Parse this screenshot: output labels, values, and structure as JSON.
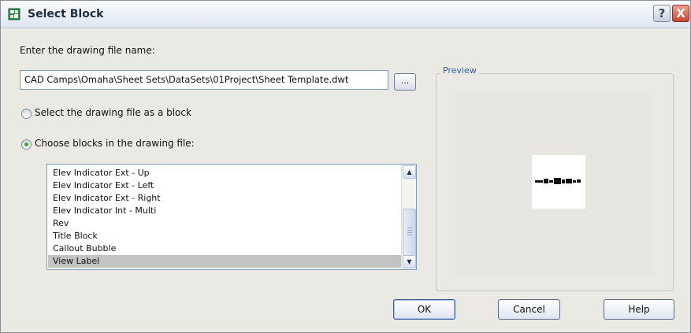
{
  "window": {
    "title": "Select Block",
    "help_button": "?",
    "close_button": "X",
    "icon": "block-icon"
  },
  "file": {
    "prompt": "Enter the drawing file name:",
    "path": "CAD Camps\\Omaha\\Sheet Sets\\DataSets\\01Project\\Sheet Template.dwt",
    "browse_label": "..."
  },
  "options": {
    "whole_file_label": "Select the drawing file as a block",
    "whole_file_selected": false,
    "choose_blocks_label": "Choose blocks in the drawing file:",
    "choose_blocks_selected": true
  },
  "blocks": {
    "items": [
      "Elev Indicator Ext - Up",
      "Elev Indicator Ext - Left",
      "Elev Indicator Ext - Right",
      "Elev Indicator Int - Multi",
      "Rev",
      "Title Block",
      "Callout Bubble",
      "View Label"
    ],
    "selected": "View Label",
    "scroll_up": "▲",
    "scroll_down": "▼"
  },
  "preview": {
    "label": "Preview"
  },
  "buttons": {
    "ok": "OK",
    "cancel": "Cancel",
    "help": "Help"
  },
  "colors": {
    "dialog_background": "#ebe9e4",
    "preview_label": "#2e5bb5",
    "radio_dot": "#3aa53a",
    "selected_row": "#c3c3c3"
  }
}
